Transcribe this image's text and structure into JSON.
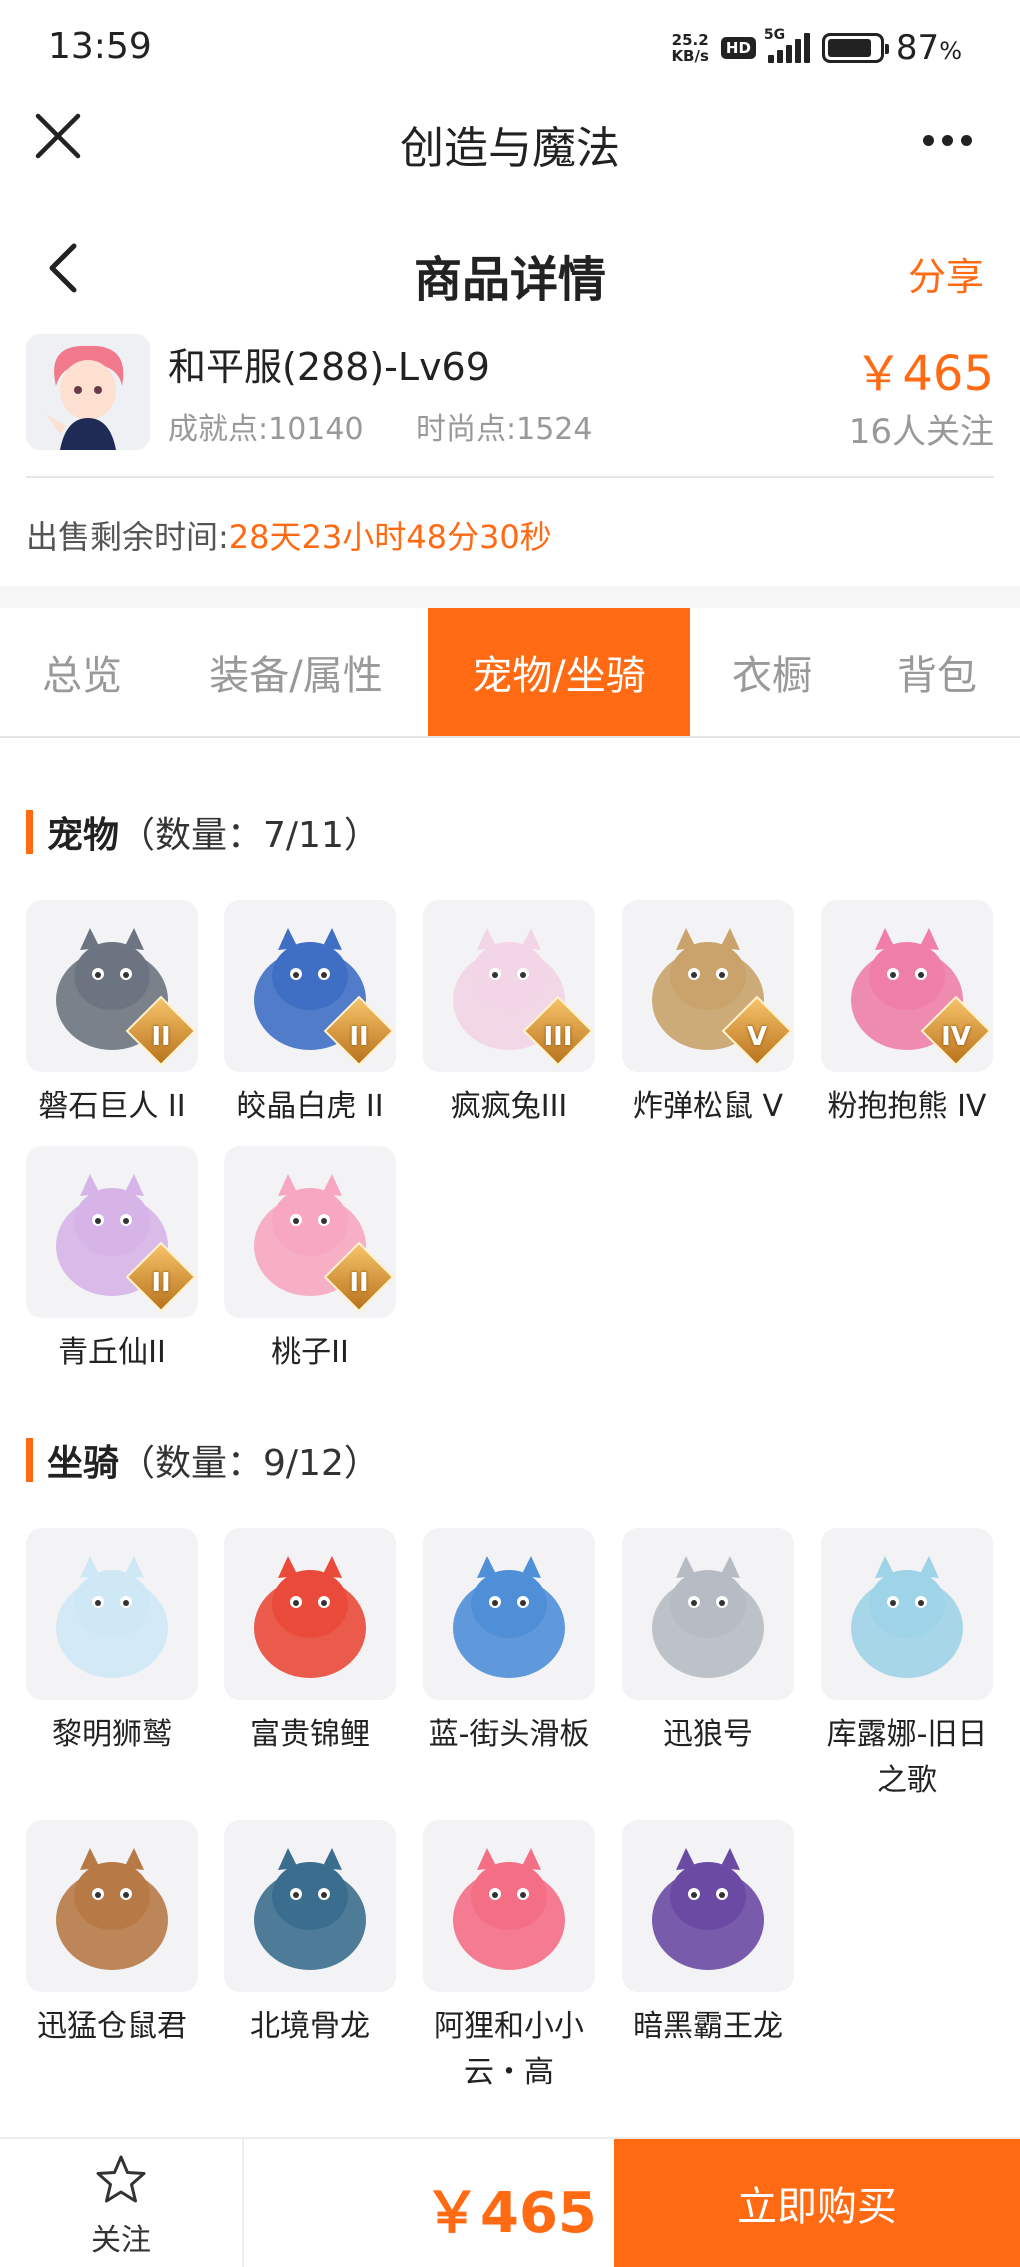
{
  "status_bar": {
    "time": "13:59",
    "net_speed_value": "25.2",
    "net_speed_unit": "KB/s",
    "hd": "HD",
    "network": "5G",
    "battery_pct": "87",
    "battery_unit": "%",
    "battery_level": 0.87
  },
  "app_bar": {
    "title": "创造与魔法"
  },
  "header": {
    "title": "商品详情",
    "share": "分享"
  },
  "product": {
    "name": "和平服(288)-Lv69",
    "achievement": "成就点:10140",
    "fashion": "时尚点:1524",
    "price": "￥465",
    "followers": "16人关注",
    "sale_time_label": "出售剩余时间:",
    "sale_time_value": "28天23小时48分30秒"
  },
  "tabs": [
    {
      "label": "总览",
      "active": false
    },
    {
      "label": "装备/属性",
      "active": false
    },
    {
      "label": "宠物/坐骑",
      "active": true
    },
    {
      "label": "衣橱",
      "active": false
    },
    {
      "label": "背包",
      "active": false
    }
  ],
  "pets": {
    "title": "宠物",
    "count": "（数量：7/11）",
    "items": [
      {
        "name": "磐石巨人 II",
        "rank": "II",
        "color": "#6b7480"
      },
      {
        "name": "皎晶白虎 II",
        "rank": "II",
        "color": "#3f6fc4"
      },
      {
        "name": "疯疯兔III",
        "rank": "III",
        "color": "#f2d5e6"
      },
      {
        "name": "炸弹松鼠 V",
        "rank": "V",
        "color": "#c9a36b"
      },
      {
        "name": "粉抱抱熊 IV",
        "rank": "IV",
        "color": "#f07fa8"
      },
      {
        "name": "青丘仙II",
        "rank": "II",
        "color": "#d6b4e8"
      },
      {
        "name": "桃子II",
        "rank": "II",
        "color": "#f7a7c1"
      }
    ]
  },
  "mounts": {
    "title": "坐骑",
    "count": "（数量：9/12）",
    "items": [
      {
        "name": "黎明狮鹫",
        "color": "#cfe8f5"
      },
      {
        "name": "富贵锦鲤",
        "color": "#e94a3a"
      },
      {
        "name": "蓝-街头滑板",
        "color": "#4f8fd8"
      },
      {
        "name": "迅狼号",
        "color": "#b7bcc4"
      },
      {
        "name": "库露娜-旧日之歌",
        "color": "#9fd3e8"
      },
      {
        "name": "迅猛仓鼠君",
        "color": "#b77a47"
      },
      {
        "name": "北境骨龙",
        "color": "#3b6e8e"
      },
      {
        "name": "阿狸和小小云・高",
        "color": "#f46e86"
      },
      {
        "name": "暗黑霸王龙",
        "color": "#6a4aa3"
      }
    ]
  },
  "bottom": {
    "follow": "关注",
    "price": "￥465",
    "buy": "立即购买"
  },
  "colors": {
    "accent": "#ff6a13",
    "muted": "#999999"
  }
}
